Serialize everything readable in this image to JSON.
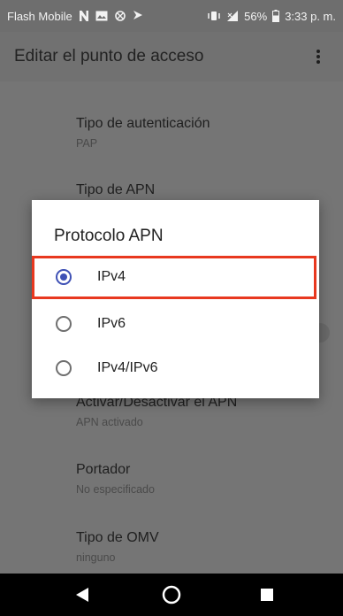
{
  "status_bar": {
    "carrier": "Flash Mobile",
    "battery": "56%",
    "time": "3:33 p. m."
  },
  "app_bar": {
    "title": "Editar el punto de acceso"
  },
  "settings": [
    {
      "title": "Tipo de autenticación",
      "subtitle": "PAP"
    },
    {
      "title": "Tipo de APN",
      "subtitle": ""
    },
    {
      "title": "Activar/Desactivar el APN",
      "subtitle": "APN activado"
    },
    {
      "title": "Portador",
      "subtitle": "No especificado"
    },
    {
      "title": "Tipo de OMV",
      "subtitle": "ninguno"
    }
  ],
  "dialog": {
    "title": "Protocolo APN",
    "options": [
      {
        "label": "IPv4",
        "selected": true
      },
      {
        "label": "IPv6",
        "selected": false
      },
      {
        "label": "IPv4/IPv6",
        "selected": false
      }
    ]
  },
  "colors": {
    "accent": "#3f51b5",
    "highlight": "#e8381f"
  }
}
